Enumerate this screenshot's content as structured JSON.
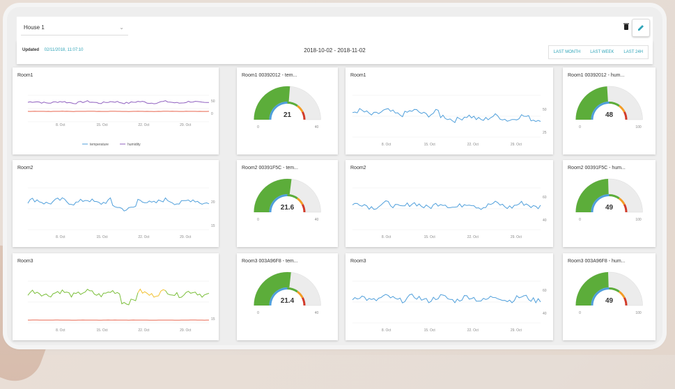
{
  "header": {
    "house_select": "House 1"
  },
  "toolbar": {
    "updated_label": "Updated",
    "updated_value": "02/11/2018, 11:07:10",
    "date_start": "2018-10-02",
    "date_sep": "-",
    "date_end": "2018-11-02",
    "ranges": [
      "LAST MONTH",
      "LAST WEEK",
      "LAST 24H"
    ]
  },
  "colors": {
    "accent": "#2fa4b8",
    "gauge_green": "#5cad3a",
    "gauge_orange": "#f39c25",
    "gauge_red": "#d23b2a",
    "blue": "#4f9fdb",
    "purple": "#8f5fbf",
    "red_line": "#e8664f",
    "green_line": "#7bbf3a",
    "yellow_line": "#f2c12e"
  },
  "x_ticks": [
    "8. Oct",
    "15. Oct",
    "22. Oct",
    "29. Oct"
  ],
  "rooms": [
    {
      "combo_title": "Room1",
      "combo_yticks": [
        "50",
        "0"
      ],
      "legend": [
        "temperature",
        "humidity"
      ],
      "temp_title": "Room1 00392012 - tem...",
      "temp_value": 21,
      "temp_display": "21",
      "temp_min": "0",
      "temp_max": "40",
      "hum_chart_title": "Room1",
      "hum_yticks": [
        "50",
        "25"
      ],
      "hum_title": "Room1 00392012 - hum...",
      "hum_value": 48,
      "hum_display": "48",
      "hum_min": "0",
      "hum_max": "100"
    },
    {
      "combo_title": "Room2",
      "combo_yticks": [
        "20",
        "15"
      ],
      "legend": [],
      "temp_title": "Room2 00391F5C - tem...",
      "temp_value": 21.6,
      "temp_display": "21.6",
      "temp_min": "0",
      "temp_max": "40",
      "hum_chart_title": "Room2",
      "hum_yticks": [
        "60",
        "40"
      ],
      "hum_title": "Room2 00391F5C - hum...",
      "hum_value": 49,
      "hum_display": "49",
      "hum_min": "0",
      "hum_max": "100"
    },
    {
      "combo_title": "Room3",
      "combo_yticks": [
        "15"
      ],
      "legend": [],
      "temp_title": "Room3 003A96F8 - tem...",
      "temp_value": 21.4,
      "temp_display": "21.4",
      "temp_min": "0",
      "temp_max": "40",
      "hum_chart_title": "Room3",
      "hum_yticks": [
        "60",
        "40"
      ],
      "hum_title": "Room3 003A96F8 - hum...",
      "hum_value": 49,
      "hum_display": "49",
      "hum_min": "0",
      "hum_max": "100"
    }
  ]
}
